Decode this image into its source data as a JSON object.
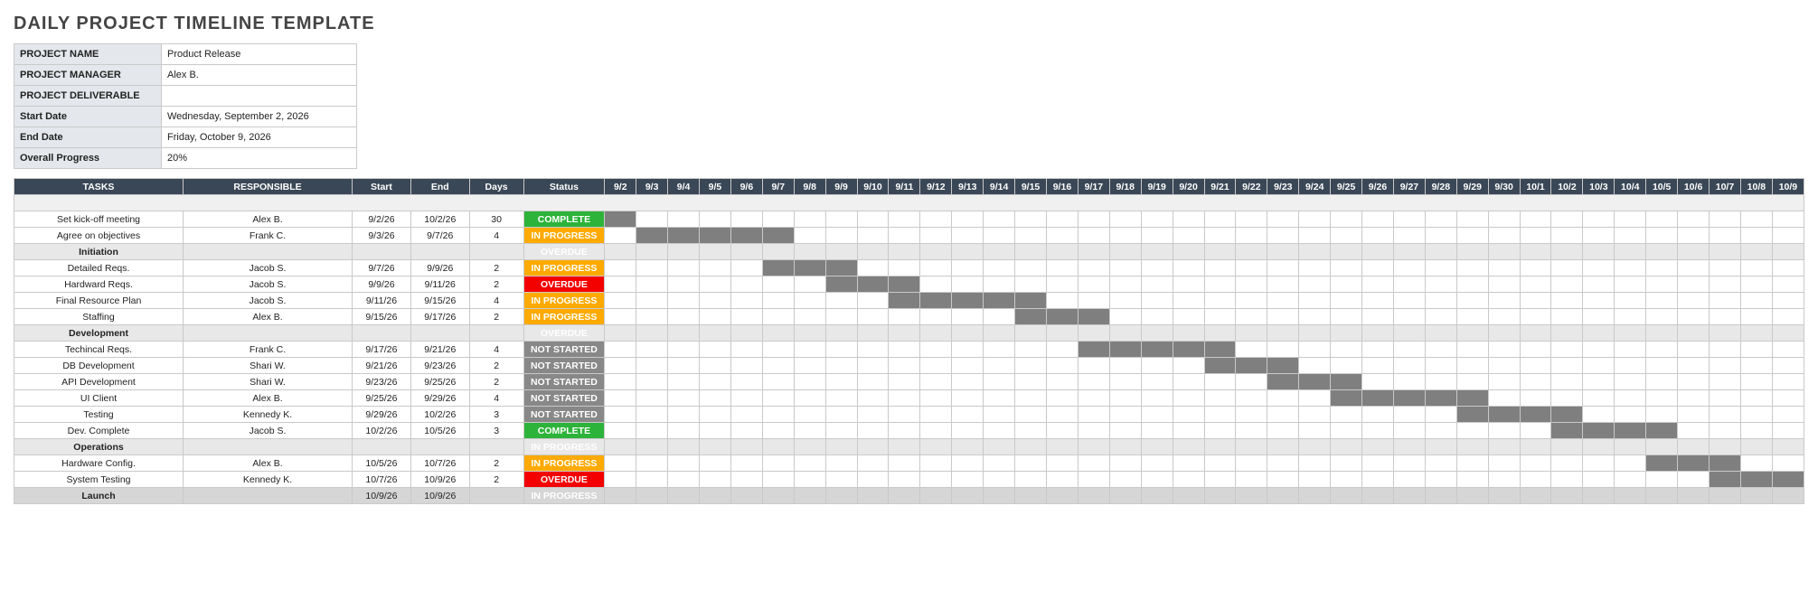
{
  "title": "DAILY PROJECT TIMELINE TEMPLATE",
  "meta": [
    {
      "label": "PROJECT NAME",
      "value": "Product Release"
    },
    {
      "label": "PROJECT MANAGER",
      "value": "Alex B."
    },
    {
      "label": "PROJECT DELIVERABLE",
      "value": ""
    },
    {
      "label": "Start Date",
      "value": "Wednesday, September 2, 2026"
    },
    {
      "label": "End Date",
      "value": "Friday, October 9, 2026"
    },
    {
      "label": "Overall Progress",
      "value": "20%"
    }
  ],
  "headers": {
    "tasks": "TASKS",
    "responsible": "RESPONSIBLE",
    "start": "Start",
    "end": "End",
    "days": "Days",
    "status": "Status"
  },
  "status_labels": {
    "complete": "COMPLETE",
    "inprogress": "IN PROGRESS",
    "overdue": "OVERDUE",
    "notstarted": "NOT STARTED"
  },
  "dates": [
    "9/2",
    "9/3",
    "9/4",
    "9/5",
    "9/6",
    "9/7",
    "9/8",
    "9/9",
    "9/10",
    "9/11",
    "9/12",
    "9/13",
    "9/14",
    "9/15",
    "9/16",
    "9/17",
    "9/18",
    "9/19",
    "9/20",
    "9/21",
    "9/22",
    "9/23",
    "9/24",
    "9/25",
    "9/26",
    "9/27",
    "9/28",
    "9/29",
    "9/30",
    "10/1",
    "10/2",
    "10/3",
    "10/4",
    "10/5",
    "10/6",
    "10/7",
    "10/8",
    "10/9"
  ],
  "rows": [
    {
      "type": "spacer"
    },
    {
      "type": "task",
      "task": "Set kick-off meeting",
      "resp": "Alex B.",
      "start": "9/2/26",
      "end": "10/2/26",
      "days": "30",
      "status": "complete",
      "bar": [
        0,
        0
      ]
    },
    {
      "type": "task",
      "task": "Agree on objectives",
      "resp": "Frank C.",
      "start": "9/3/26",
      "end": "9/7/26",
      "days": "4",
      "status": "inprogress",
      "bar": [
        1,
        5
      ]
    },
    {
      "type": "phase",
      "task": "Initiation",
      "status": "overdue"
    },
    {
      "type": "task",
      "task": "Detailed Reqs.",
      "resp": "Jacob S.",
      "start": "9/7/26",
      "end": "9/9/26",
      "days": "2",
      "status": "inprogress",
      "bar": [
        5,
        7
      ]
    },
    {
      "type": "task",
      "task": "Hardward Reqs.",
      "resp": "Jacob S.",
      "start": "9/9/26",
      "end": "9/11/26",
      "days": "2",
      "status": "overdue",
      "bar": [
        7,
        9
      ]
    },
    {
      "type": "task",
      "task": "Final Resource Plan",
      "resp": "Jacob S.",
      "start": "9/11/26",
      "end": "9/15/26",
      "days": "4",
      "status": "inprogress",
      "bar": [
        9,
        13
      ]
    },
    {
      "type": "task",
      "task": "Staffing",
      "resp": "Alex B.",
      "start": "9/15/26",
      "end": "9/17/26",
      "days": "2",
      "status": "inprogress",
      "bar": [
        13,
        15
      ]
    },
    {
      "type": "phase",
      "task": "Development",
      "status": "overdue"
    },
    {
      "type": "task",
      "task": "Techincal Reqs.",
      "resp": "Frank C.",
      "start": "9/17/26",
      "end": "9/21/26",
      "days": "4",
      "status": "notstarted",
      "bar": [
        15,
        19
      ]
    },
    {
      "type": "task",
      "task": "DB Development",
      "resp": "Shari W.",
      "start": "9/21/26",
      "end": "9/23/26",
      "days": "2",
      "status": "notstarted",
      "bar": [
        19,
        21
      ]
    },
    {
      "type": "task",
      "task": "API Development",
      "resp": "Shari W.",
      "start": "9/23/26",
      "end": "9/25/26",
      "days": "2",
      "status": "notstarted",
      "bar": [
        21,
        23
      ]
    },
    {
      "type": "task",
      "task": "UI Client",
      "resp": "Alex B.",
      "start": "9/25/26",
      "end": "9/29/26",
      "days": "4",
      "status": "notstarted",
      "bar": [
        23,
        27
      ]
    },
    {
      "type": "task",
      "task": "Testing",
      "resp": "Kennedy K.",
      "start": "9/29/26",
      "end": "10/2/26",
      "days": "3",
      "status": "notstarted",
      "bar": [
        27,
        30
      ]
    },
    {
      "type": "task",
      "task": "Dev. Complete",
      "resp": "Jacob S.",
      "start": "10/2/26",
      "end": "10/5/26",
      "days": "3",
      "status": "complete",
      "bar": [
        30,
        33
      ]
    },
    {
      "type": "phase",
      "task": "Operations",
      "status": "inprogress"
    },
    {
      "type": "task",
      "task": "Hardware Config.",
      "resp": "Alex B.",
      "start": "10/5/26",
      "end": "10/7/26",
      "days": "2",
      "status": "inprogress",
      "bar": [
        33,
        35
      ]
    },
    {
      "type": "task",
      "task": "System Testing",
      "resp": "Kennedy K.",
      "start": "10/7/26",
      "end": "10/9/26",
      "days": "2",
      "status": "overdue",
      "bar": [
        35,
        37
      ]
    },
    {
      "type": "phase",
      "strong": true,
      "task": "Launch",
      "start": "10/9/26",
      "end": "10/9/26",
      "status": "inprogress"
    }
  ]
}
